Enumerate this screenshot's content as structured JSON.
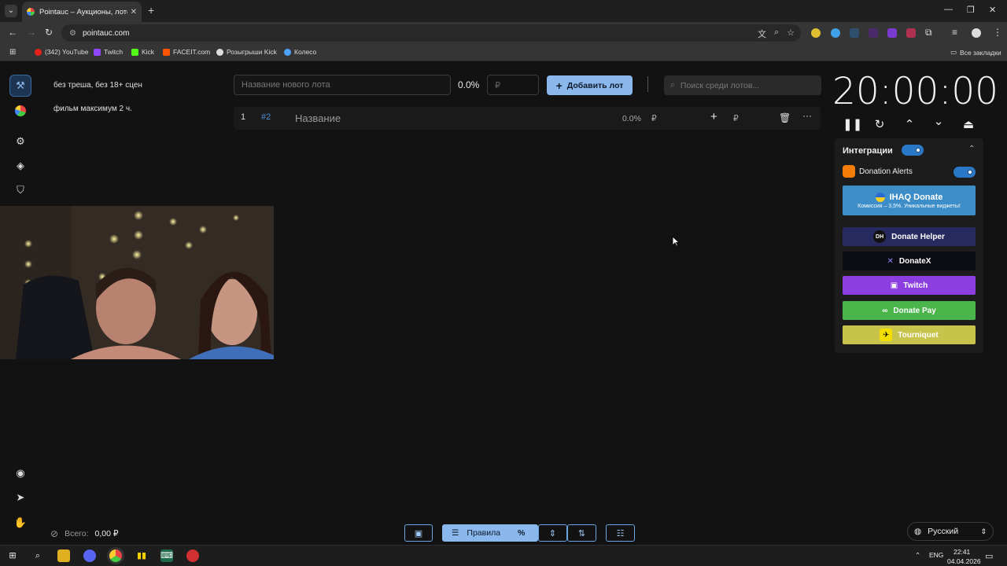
{
  "browser": {
    "tab_title": "Pointauc – Аукционы, лотереи",
    "url": "pointauc.com",
    "bookmarks": [
      {
        "label": "(342) YouTube",
        "color": "#e62117"
      },
      {
        "label": "Twitch",
        "color": "#9147ff"
      },
      {
        "label": "Kick",
        "color": "#53fc18"
      },
      {
        "label": "FACEIT.com",
        "color": "#ff5500"
      },
      {
        "label": "Розыгрыши Kick",
        "color": "#dddddd"
      },
      {
        "label": "Колесо",
        "color": "#4aa3ff"
      }
    ],
    "all_bookmarks": "Все закладки"
  },
  "rules": {
    "line1": "без треша, без 18+ сцен",
    "line2": "фильм максимум 2 ч."
  },
  "toolbar": {
    "lot_placeholder": "Название нового лота",
    "percent": "0.0%",
    "amount_placeholder": "₽",
    "add_label": "Добавить лот",
    "search_placeholder": "Поиск среди лотов..."
  },
  "lots": [
    {
      "index": "1",
      "id": "#2",
      "name": "Название",
      "percent": "0.0%",
      "currency": "₽",
      "add_currency": "₽"
    }
  ],
  "timer": "20:00:00",
  "integrations": {
    "title": "Интеграции",
    "donation_alerts": "Donation Alerts",
    "ihaq_title": "IHAQ Donate",
    "ihaq_sub": "Комиссия – 3,5%. Уникальные виджеты!",
    "buttons": [
      {
        "label": "Donate Helper",
        "color": "#262a5e"
      },
      {
        "label": "DonateX",
        "color": "#0b0b14"
      },
      {
        "label": "Twitch",
        "color": "#8c3ee0"
      },
      {
        "label": "Donate Pay",
        "color": "#49b54a"
      },
      {
        "label": "Tourniquet",
        "color": "#c8c34a"
      }
    ]
  },
  "footer": {
    "total_label": "Всего:",
    "total_value": "0,00 ₽",
    "rules_label": "Правила",
    "language": "Русский"
  },
  "taskbar": {
    "lang": "ENG",
    "time": "22:41",
    "date": "04.04.2026"
  }
}
